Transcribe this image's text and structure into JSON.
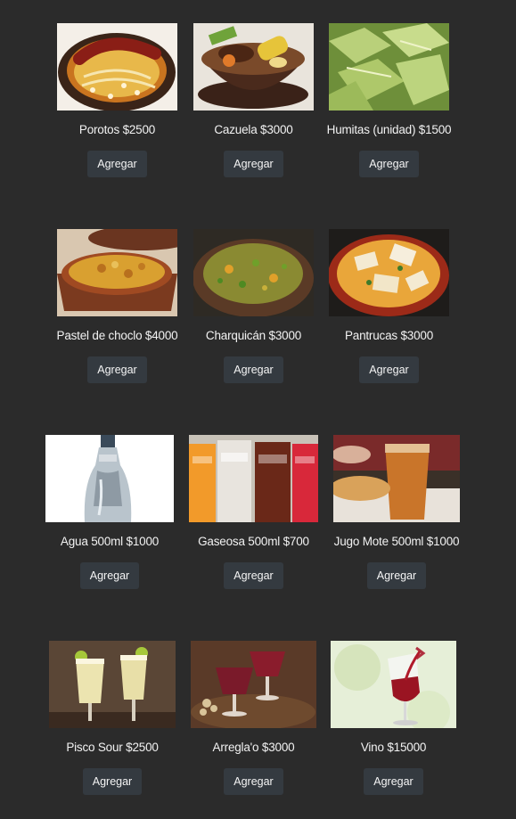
{
  "button_label": "Agregar",
  "rows": [
    {
      "items": [
        {
          "label": "Porotos $2500",
          "image": "porotos-photo"
        },
        {
          "label": "Cazuela $3000",
          "image": "cazuela-photo"
        },
        {
          "label": "Humitas (unidad) $1500",
          "image": "humitas-photo"
        }
      ]
    },
    {
      "items": [
        {
          "label": "Pastel de choclo $4000",
          "image": "pastel-de-choclo-photo"
        },
        {
          "label": "Charquicán $3000",
          "image": "charquican-photo"
        },
        {
          "label": "Pantrucas $3000",
          "image": "pantrucas-photo"
        }
      ]
    },
    {
      "items": [
        {
          "label": "Agua 500ml $1000",
          "image": "agua-photo"
        },
        {
          "label": "Gaseosa 500ml $700",
          "image": "gaseosa-photo"
        },
        {
          "label": "Jugo Mote 500ml $1000",
          "image": "jugo-mote-photo"
        }
      ]
    },
    {
      "items": [
        {
          "label": "Pisco Sour $2500",
          "image": "pisco-sour-photo"
        },
        {
          "label": "Arregla'o $3000",
          "image": "arreglao-photo"
        },
        {
          "label": "Vino $15000",
          "image": "vino-photo"
        }
      ]
    }
  ]
}
